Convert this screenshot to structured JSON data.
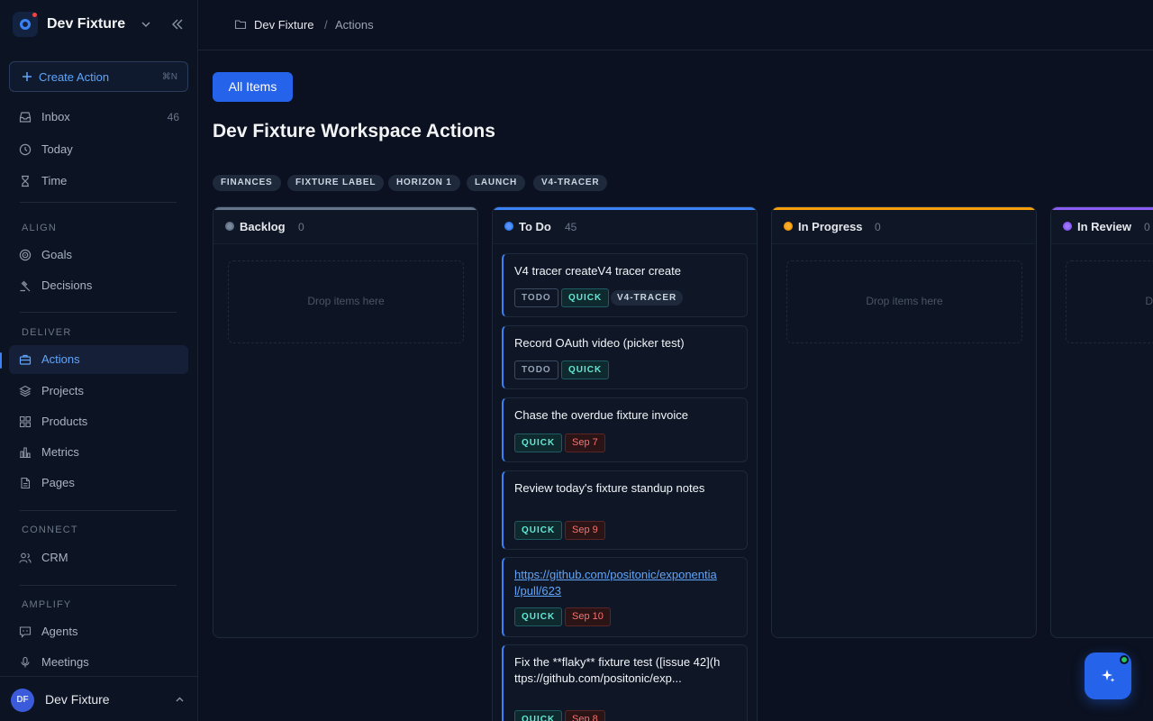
{
  "workspace": {
    "name": "Dev Fixture"
  },
  "sidebar": {
    "create": {
      "label": "Create Action",
      "shortcut": "⌘N"
    },
    "top_items": [
      {
        "label": "Inbox",
        "count": "46"
      },
      {
        "label": "Today"
      },
      {
        "label": "Time"
      }
    ],
    "sections": {
      "align": "ALIGN",
      "deliver": "DELIVER",
      "connect": "CONNECT",
      "amplify": "AMPLIFY"
    },
    "align_items": [
      {
        "label": "Goals"
      },
      {
        "label": "Decisions"
      }
    ],
    "deliver_items": [
      {
        "label": "Actions"
      },
      {
        "label": "Projects"
      },
      {
        "label": "Products"
      },
      {
        "label": "Metrics"
      },
      {
        "label": "Pages"
      }
    ],
    "connect_items": [
      {
        "label": "CRM"
      }
    ],
    "amplify_items": [
      {
        "label": "Agents"
      },
      {
        "label": "Meetings"
      }
    ],
    "user": {
      "initials": "DF",
      "name": "Dev Fixture"
    }
  },
  "breadcrumb": {
    "workspace": "Dev Fixture",
    "separator": "/",
    "page": "Actions"
  },
  "main": {
    "filter_button": "All Items",
    "title": "Dev Fixture Workspace Actions",
    "labels": [
      "FINANCES",
      "FIXTURE LABEL",
      "HORIZON 1",
      "LAUNCH",
      "V4-TRACER"
    ]
  },
  "board": {
    "drop_text": "Drop items here",
    "columns": [
      {
        "title": "Backlog",
        "count": "0",
        "color": "#64748b"
      },
      {
        "title": "To Do",
        "count": "45",
        "color": "#3b82f6"
      },
      {
        "title": "In Progress",
        "count": "0",
        "color": "#f59e0b"
      },
      {
        "title": "In Review",
        "count": "0",
        "color": "#8b5cf6"
      }
    ],
    "cards": [
      {
        "title": "V4 tracer createV4 tracer create",
        "tags": [
          "TODO",
          "QUICK",
          "V4-TRACER"
        ]
      },
      {
        "title": "Record OAuth video (picker test)",
        "tags": [
          "TODO",
          "QUICK"
        ]
      },
      {
        "title": "Chase the overdue fixture invoice",
        "tags": [
          "QUICK"
        ],
        "date": "Sep 7"
      },
      {
        "title": "Review today's fixture standup notes",
        "tags": [
          "QUICK"
        ],
        "date": "Sep 9"
      },
      {
        "title": "https://github.com/positonic/exponential/pull/623",
        "tags": [
          "QUICK"
        ],
        "date": "Sep 10"
      },
      {
        "title": "Fix the **flaky** fixture test ([issue 42](https://github.com/positonic/exp...",
        "tags": [
          "QUICK"
        ],
        "date": "Sep 8"
      }
    ]
  },
  "icons": {
    "fab": "sparkle-icon"
  }
}
